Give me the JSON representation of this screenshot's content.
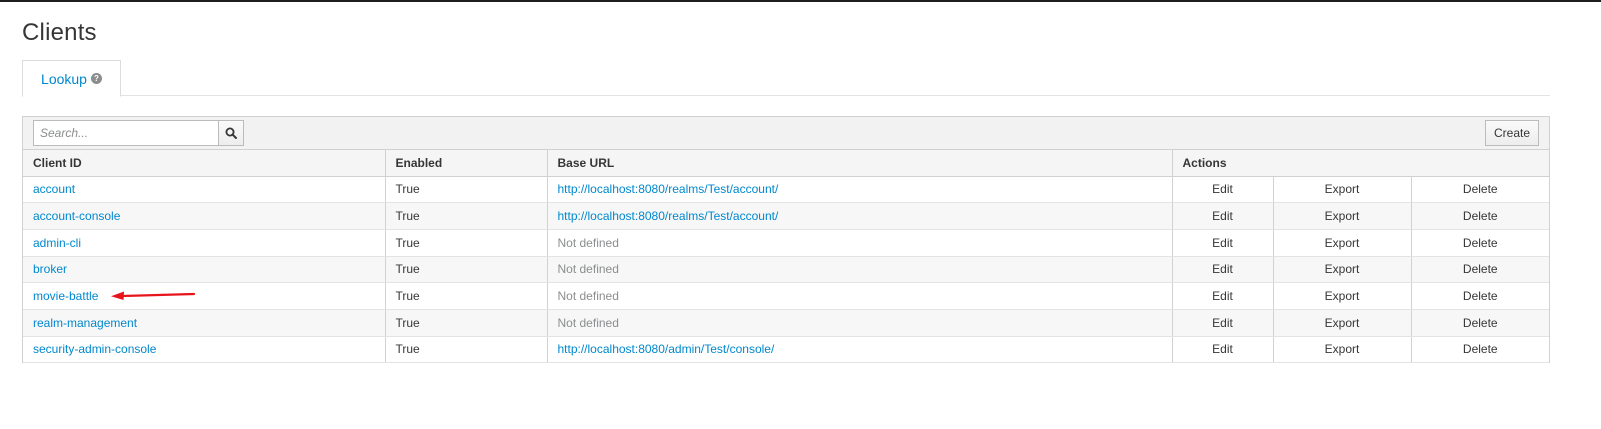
{
  "page": {
    "title": "Clients"
  },
  "tabs": [
    {
      "label": "Lookup"
    }
  ],
  "toolbar": {
    "search_placeholder": "Search...",
    "create_label": "Create"
  },
  "table": {
    "columns": [
      "Client ID",
      "Enabled",
      "Base URL",
      "Actions"
    ],
    "actions": [
      "Edit",
      "Export",
      "Delete"
    ],
    "rows": [
      {
        "client_id": "account",
        "enabled": "True",
        "base_url": "http://localhost:8080/realms/Test/account/"
      },
      {
        "client_id": "account-console",
        "enabled": "True",
        "base_url": "http://localhost:8080/realms/Test/account/"
      },
      {
        "client_id": "admin-cli",
        "enabled": "True",
        "base_url": "Not defined"
      },
      {
        "client_id": "broker",
        "enabled": "True",
        "base_url": "Not defined"
      },
      {
        "client_id": "movie-battle",
        "enabled": "True",
        "base_url": "Not defined"
      },
      {
        "client_id": "realm-management",
        "enabled": "True",
        "base_url": "Not defined"
      },
      {
        "client_id": "security-admin-console",
        "enabled": "True",
        "base_url": "http://localhost:8080/admin/Test/console/"
      }
    ]
  },
  "colors": {
    "link": "#0088ce",
    "muted": "#8b8d8f",
    "annotation_arrow": "#e8141b"
  }
}
